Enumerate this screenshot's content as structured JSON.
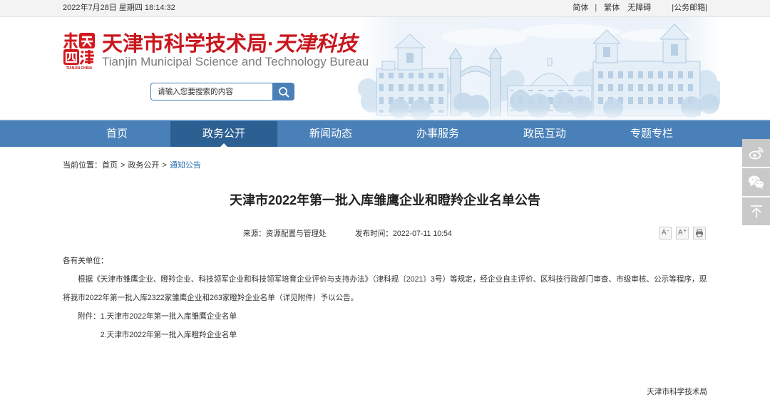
{
  "topbar": {
    "datetime": "2022年7月28日 星期四 18:14:32",
    "links": {
      "simplified": "简体",
      "separator": "|",
      "traditional": "繁体",
      "accessibility": "无障碍",
      "mail": "|公务邮箱|"
    }
  },
  "header": {
    "logo_icon": "tianjin-emblem-icon",
    "logo_caption": "TIANJIN CHINA",
    "title_main": "天津市科学技术局",
    "title_dot": "·",
    "title_brand": "天津科技",
    "subtitle": "Tianjin Municipal Science and Technology Bureau",
    "banner_icon": "campus-buildings-illustration"
  },
  "search": {
    "placeholder": "请输入您要搜索的内容",
    "button_icon": "search-icon"
  },
  "nav": {
    "items": [
      {
        "label": "首页",
        "active": false
      },
      {
        "label": "政务公开",
        "active": true
      },
      {
        "label": "新闻动态",
        "active": false
      },
      {
        "label": "办事服务",
        "active": false
      },
      {
        "label": "政民互动",
        "active": false
      },
      {
        "label": "专题专栏",
        "active": false
      }
    ]
  },
  "share": {
    "buttons": [
      {
        "icon": "weibo-icon"
      },
      {
        "icon": "wechat-icon"
      },
      {
        "icon": "back-to-top-icon"
      }
    ]
  },
  "breadcrumb": {
    "prefix": "当前位置：",
    "separator": ">",
    "items": [
      "首页",
      "政务公开",
      "通知公告"
    ]
  },
  "article": {
    "title": "天津市2022年第一批入库雏鹰企业和瞪羚企业名单公告",
    "source_label": "来源：",
    "source": "资源配置与管理处",
    "date_label": "发布时间：",
    "date": "2022-07-11 10:54",
    "tools": {
      "font_smaller": {
        "letter": "A",
        "sign": "-"
      },
      "font_larger": {
        "letter": "A",
        "sign": "+"
      },
      "print_icon": "print-icon"
    },
    "greeting": "各有关单位：",
    "paragraph": "根据《天津市雏鹰企业、瞪羚企业、科技领军企业和科技领军培育企业评价与支持办法》（津科规〔2021〕3号）等规定，经企业自主评价、区科技行政部门审查、市级审核、公示等程序，现将我市2022年第一批入库2322家雏鹰企业和263家瞪羚企业名单（详见附件）予以公告。",
    "attachments": {
      "label": "附件：",
      "items": [
        "1.天津市2022年第一批入库雏鹰企业名单",
        "2.天津市2022年第一批入库瞪羚企业名单"
      ]
    },
    "signature": "天津市科学技术局"
  },
  "colors": {
    "nav": "#4a80b8",
    "nav_active": "#2c5f92",
    "brand_red": "#c8161d",
    "link": "#2a6db0",
    "share_bg": "#c9c9c9",
    "topbar_bg": "#f3f3f3",
    "text": "#333333"
  }
}
